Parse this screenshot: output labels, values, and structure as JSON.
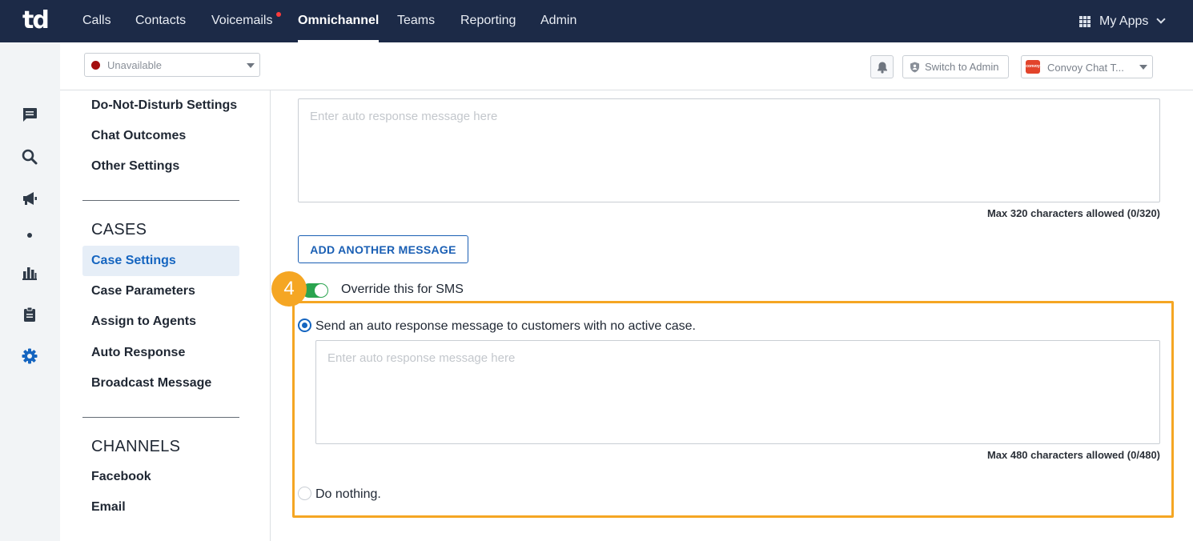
{
  "app": {
    "logo_text": "td"
  },
  "nav": {
    "items": [
      {
        "label": "Calls"
      },
      {
        "label": "Contacts"
      },
      {
        "label": "Voicemails"
      },
      {
        "label": "Omnichannel"
      },
      {
        "label": "Teams"
      },
      {
        "label": "Reporting"
      },
      {
        "label": "Admin"
      }
    ],
    "active": "Omnichannel",
    "my_apps_label": "My Apps"
  },
  "subheader": {
    "status_value": "Unavailable",
    "switch_admin_label": "Switch to Admin",
    "chat_select_value": "Convoy Chat T...",
    "chat_logo_text": "convoy"
  },
  "settings_nav": {
    "items_top": [
      "Do-Not-Disturb Settings",
      "Chat Outcomes",
      "Other Settings"
    ],
    "cases_heading": "CASES",
    "cases_items": [
      "Case Settings",
      "Case Parameters",
      "Assign to Agents",
      "Auto Response",
      "Broadcast Message"
    ],
    "active_item": "Case Settings",
    "channels_heading": "CHANNELS",
    "channels_items": [
      "Facebook",
      "Email"
    ]
  },
  "main": {
    "message1": {
      "placeholder": "Enter auto response message here",
      "value": "",
      "hint": "Max 320 characters allowed (0/320)"
    },
    "add_message_label": "ADD ANOTHER MESSAGE",
    "step_number": "4",
    "override_toggle": {
      "label": "Override this for SMS",
      "on": true
    },
    "option_send": {
      "label": "Send an auto response message to customers with no active case.",
      "checked": true
    },
    "message2": {
      "placeholder": "Enter auto response message here",
      "value": "",
      "hint": "Max 480 characters allowed (0/480)"
    },
    "option_nothing": {
      "label": "Do nothing.",
      "checked": false
    }
  },
  "colors": {
    "topnav_bg": "#1c2a47",
    "accent_blue": "#1565c0",
    "highlight_orange": "#f5a623",
    "toggle_green": "#2aa44f",
    "status_unavailable": "#a40e0e"
  },
  "icons": {
    "rail": [
      "chat-icon",
      "search-icon",
      "megaphone-icon",
      "dot-icon",
      "bar-chart-icon",
      "clipboard-icon",
      "gear-icon"
    ],
    "header": [
      "grid-icon",
      "chevron-down-icon",
      "bell-icon",
      "shield-icon"
    ]
  }
}
